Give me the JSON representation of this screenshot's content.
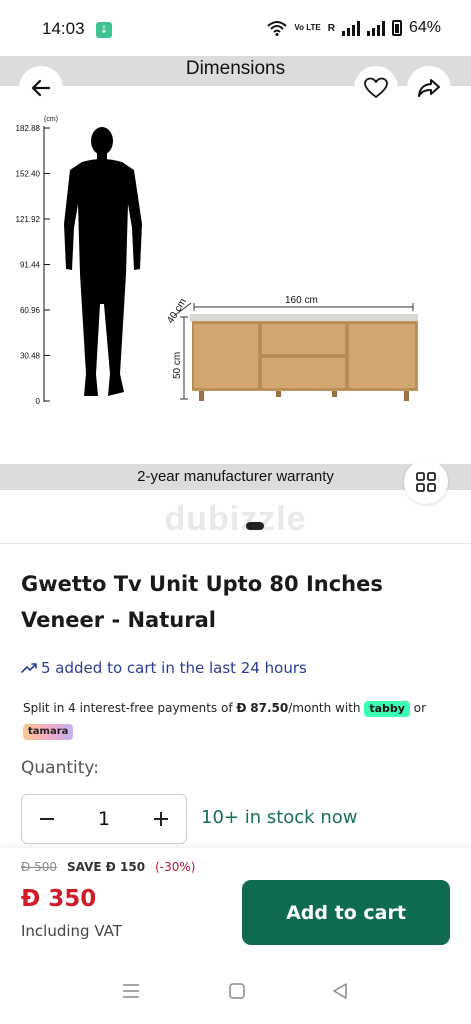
{
  "status_bar": {
    "time": "14:03",
    "network": "Vo LTE",
    "roaming": "R",
    "battery": "64%"
  },
  "gallery": {
    "header_label": "Dimensions",
    "warranty_label": "2-year manufacturer warranty",
    "watermark": "dubizzle",
    "figure": {
      "unit": "(cm)",
      "height_scale": [
        "182.88",
        "152.40",
        "121.92",
        "91.44",
        "60.96",
        "30.48",
        "0"
      ],
      "width_label": "160 cm",
      "depth_label": "40 cm",
      "height_label": "50 cm"
    }
  },
  "product": {
    "title": "Gwetto Tv Unit Upto 80 Inches Veneer - Natural",
    "cart_activity": "5 added to cart in the last 24 hours",
    "installments": {
      "text_before": "Split in 4 interest-free payments of",
      "currency_symbol": "Đ",
      "amount": "87.50",
      "text_after": "/month with",
      "provider_1": "tabby",
      "or_text": "or",
      "provider_2": "tamara"
    },
    "quantity_label": "Quantity:",
    "quantity_value": "1",
    "stock_text": "10+ in stock now"
  },
  "pricing": {
    "old_price": "Đ 500",
    "save_text": "SAVE Đ 150",
    "discount_text": "(-30%)",
    "price": "Đ 350",
    "vat_text": "Including VAT",
    "add_to_cart_label": "Add to cart"
  },
  "colors": {
    "brand_green": "#0e6b52",
    "price_red": "#d11a2a",
    "stock_green": "#17704f",
    "activity_blue": "#2a3d8f"
  },
  "icons": {
    "back": "arrow-left-icon",
    "favorite": "heart-icon",
    "share": "share-icon",
    "gallery_grid": "grid-icon",
    "trend": "trending-up-icon",
    "minus": "minus-icon",
    "plus": "plus-icon"
  }
}
